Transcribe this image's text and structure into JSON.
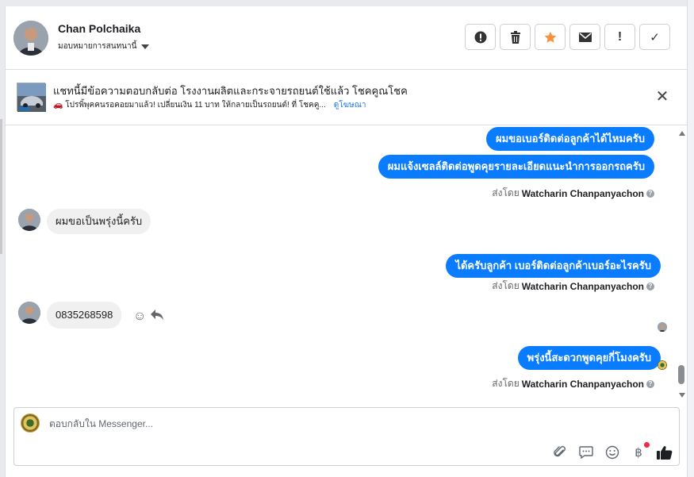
{
  "header": {
    "name": "Chan Polchaika",
    "assign_label": "มอบหมายการสนทนานี้",
    "actions": [
      {
        "icon": "alert-circle-icon",
        "glyph": "!"
      },
      {
        "icon": "trash-icon",
        "glyph": "🗑"
      },
      {
        "icon": "star-icon",
        "glyph": "★"
      },
      {
        "icon": "envelope-icon",
        "glyph": "✉"
      },
      {
        "icon": "exclamation-icon",
        "glyph": "!"
      },
      {
        "icon": "check-icon",
        "glyph": "✓"
      }
    ]
  },
  "ad_banner": {
    "title": "แชทนี้มีข้อความตอบกลับต่อ โรงงานผลิตและกระจายรถยนต์ใช้แล้ว โชคคูณโชค",
    "subtitle": "🚗 โปรพิ้พุคคนรอคอยมาแล้ว! เปลี่ยนเงิน 11 บาท ให้กลายเป็นรถยนต์! ที่ โชคคู...",
    "link": "ดูโฆษณา",
    "close_glyph": "✕"
  },
  "messages": {
    "out1": "ผมขอเบอร์ติดต่อลูกค้าได้ไหมครับ",
    "out2": "ผมแจ้งเซลล์ติดต่อพูดคุยรายละเอียดแนะนำการออกรถครับ",
    "sent_by_1_prefix": "ส่งโดย",
    "sent_by_1_name": "Watcharin Chanpanyachon",
    "in1": "ผมขอเป็นพรุ่งนี้ครับ",
    "out3": "ได้ครับลูกค้า เบอร์ติดต่อลูกค้าเบอร์อะไรครับ",
    "sent_by_2_prefix": "ส่งโดย",
    "sent_by_2_name": "Watcharin Chanpanyachon",
    "in2": "0835268598",
    "out4": "พรุ่งนี้สะดวกพูดคุยกี่โมงครับ",
    "sent_by_3_prefix": "ส่งโดย",
    "sent_by_3_name": "Watcharin Chanpanyachon"
  },
  "composer": {
    "placeholder": "ตอบกลับใน Messenger...",
    "tools": [
      "paperclip-icon",
      "saved-reply-icon",
      "emoji-icon",
      "baht-payment-icon",
      "thumbs-up-icon"
    ]
  }
}
